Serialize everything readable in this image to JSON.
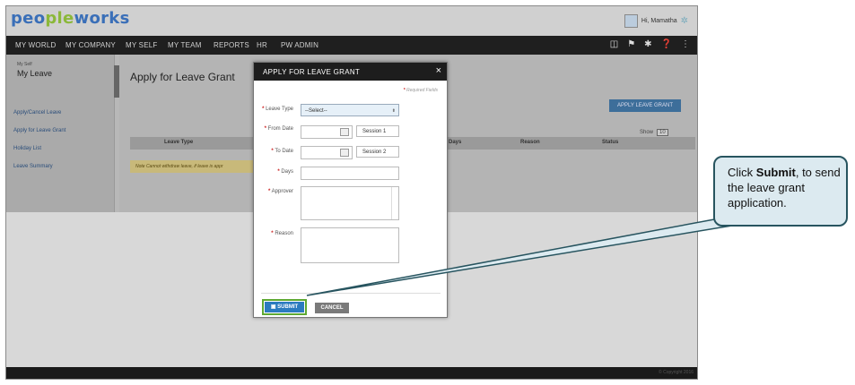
{
  "app": {
    "logo_part1": "peo",
    "logo_part2": "ple",
    "logo_part3": "works",
    "greeting": "Hi, Mamatha"
  },
  "nav": {
    "items": [
      "MY WORLD",
      "MY COMPANY",
      "MY SELF",
      "MY TEAM",
      "REPORTS",
      "HR",
      "PW ADMIN"
    ],
    "icons": [
      "book-icon",
      "flag-icon",
      "tools-icon",
      "help-icon",
      "menu-icon"
    ]
  },
  "sidebar": {
    "section_label": "My Self",
    "title": "My Leave",
    "links": [
      "Apply/Cancel Leave",
      "Apply for Leave Grant",
      "Holiday List",
      "Leave Summary"
    ]
  },
  "main": {
    "page_title": "Apply for Leave Grant",
    "apply_button": "APPLY LEAVE GRANT",
    "show_label": "Show",
    "show_value": "10",
    "columns": [
      "Leave Type",
      "Days",
      "Reason",
      "Status"
    ],
    "note": "Note Cannot withdraw leave, if leave is appr"
  },
  "modal": {
    "title": "APPLY FOR LEAVE GRANT",
    "close": "×",
    "required_note": "Required Fields",
    "fields": {
      "leave_type_label": "Leave Type",
      "leave_type_value": "--Select--",
      "from_date_label": "From Date",
      "from_session": "Session 1",
      "to_date_label": "To Date",
      "to_session": "Session 2",
      "days_label": "Days",
      "approver_label": "Approver",
      "reason_label": "Reason"
    },
    "submit_label": "SUBMIT",
    "cancel_label": "CANCEL"
  },
  "footer": {
    "copyright": "© Copyright 2016"
  },
  "callout": {
    "prefix": "Click ",
    "bold": "Submit",
    "suffix": ", to send the leave grant application."
  },
  "colors": {
    "accent_green": "#5ea832",
    "submit_blue": "#2b7bbf",
    "callout_border": "#27545f"
  }
}
